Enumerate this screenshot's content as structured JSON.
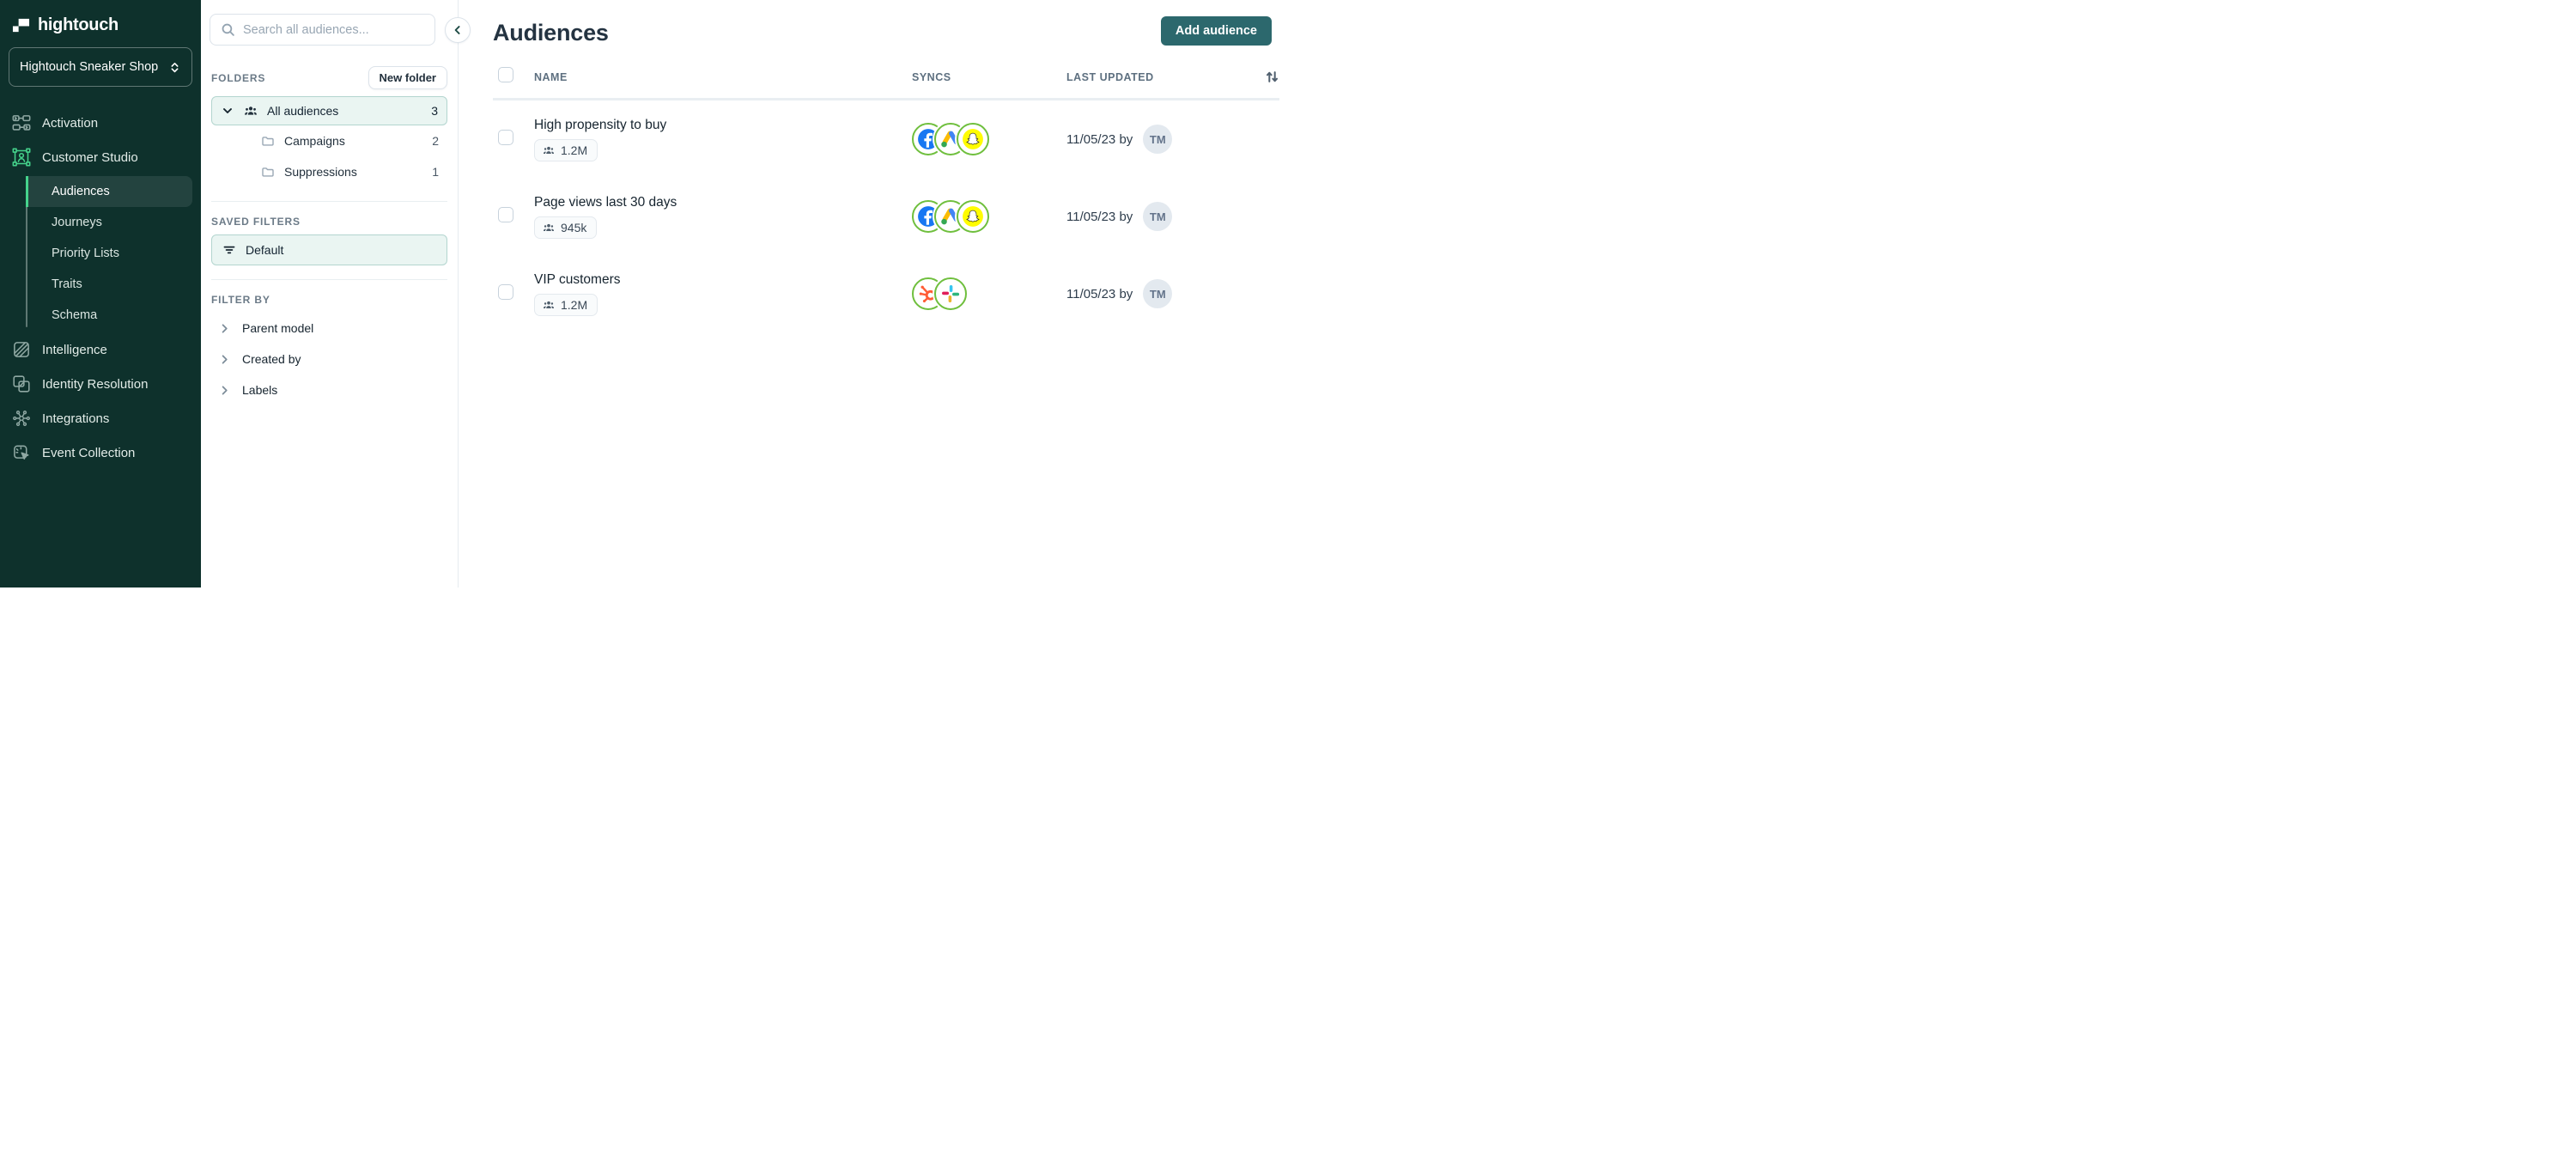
{
  "colors": {
    "sidebar_bg": "#0E312C",
    "accent_green": "#45D38C",
    "sync_ring_green": "#6FBF3D",
    "primary_button_teal": "#2C686D",
    "selection_bg": "#EAF5F2",
    "selection_border": "#B3D5CF",
    "facebook_blue": "#1877F2",
    "snapchat_yellow": "#FFFC00",
    "hubspot_coral": "#FF5C35"
  },
  "sidebar": {
    "logo": "hightouch",
    "workspace": {
      "name": "Hightouch Sneaker Shop"
    },
    "nav": [
      {
        "label": "Activation",
        "icon": "activation-icon"
      },
      {
        "label": "Customer Studio",
        "icon": "customer-studio-icon"
      },
      {
        "label": "Intelligence",
        "icon": "intelligence-icon"
      },
      {
        "label": "Identity Resolution",
        "icon": "identity-resolution-icon"
      },
      {
        "label": "Integrations",
        "icon": "integrations-icon"
      },
      {
        "label": "Event Collection",
        "icon": "event-collection-icon"
      }
    ],
    "customer_studio_children": [
      {
        "label": "Audiences",
        "active": true
      },
      {
        "label": "Journeys",
        "active": false
      },
      {
        "label": "Priority Lists",
        "active": false
      },
      {
        "label": "Traits",
        "active": false
      },
      {
        "label": "Schema",
        "active": false
      }
    ]
  },
  "panel": {
    "search_placeholder": "Search all audiences...",
    "folders": {
      "title": "FOLDERS",
      "new_folder_label": "New folder",
      "root": {
        "label": "All audiences",
        "count": "3"
      },
      "children": [
        {
          "label": "Campaigns",
          "count": "2"
        },
        {
          "label": "Suppressions",
          "count": "1"
        }
      ]
    },
    "saved_filters": {
      "title": "SAVED FILTERS",
      "items": [
        {
          "label": "Default"
        }
      ]
    },
    "filter_by": {
      "title": "FILTER BY",
      "items": [
        {
          "label": "Parent model"
        },
        {
          "label": "Created by"
        },
        {
          "label": "Labels"
        }
      ]
    }
  },
  "main": {
    "title": "Audiences",
    "add_button": "Add audience",
    "table": {
      "columns": [
        "NAME",
        "SYNCS",
        "LAST UPDATED"
      ],
      "rows": [
        {
          "name": "High propensity to buy",
          "size": "1.2M",
          "syncs": [
            "facebook",
            "google-ads",
            "snapchat"
          ],
          "updated": "11/05/23 by",
          "avatar": "TM"
        },
        {
          "name": "Page views last 30 days",
          "size": "945k",
          "syncs": [
            "facebook",
            "google-ads",
            "snapchat"
          ],
          "updated": "11/05/23 by",
          "avatar": "TM"
        },
        {
          "name": "VIP customers",
          "size": "1.2M",
          "syncs": [
            "hubspot",
            "slack"
          ],
          "updated": "11/05/23 by",
          "avatar": "TM"
        }
      ]
    }
  }
}
